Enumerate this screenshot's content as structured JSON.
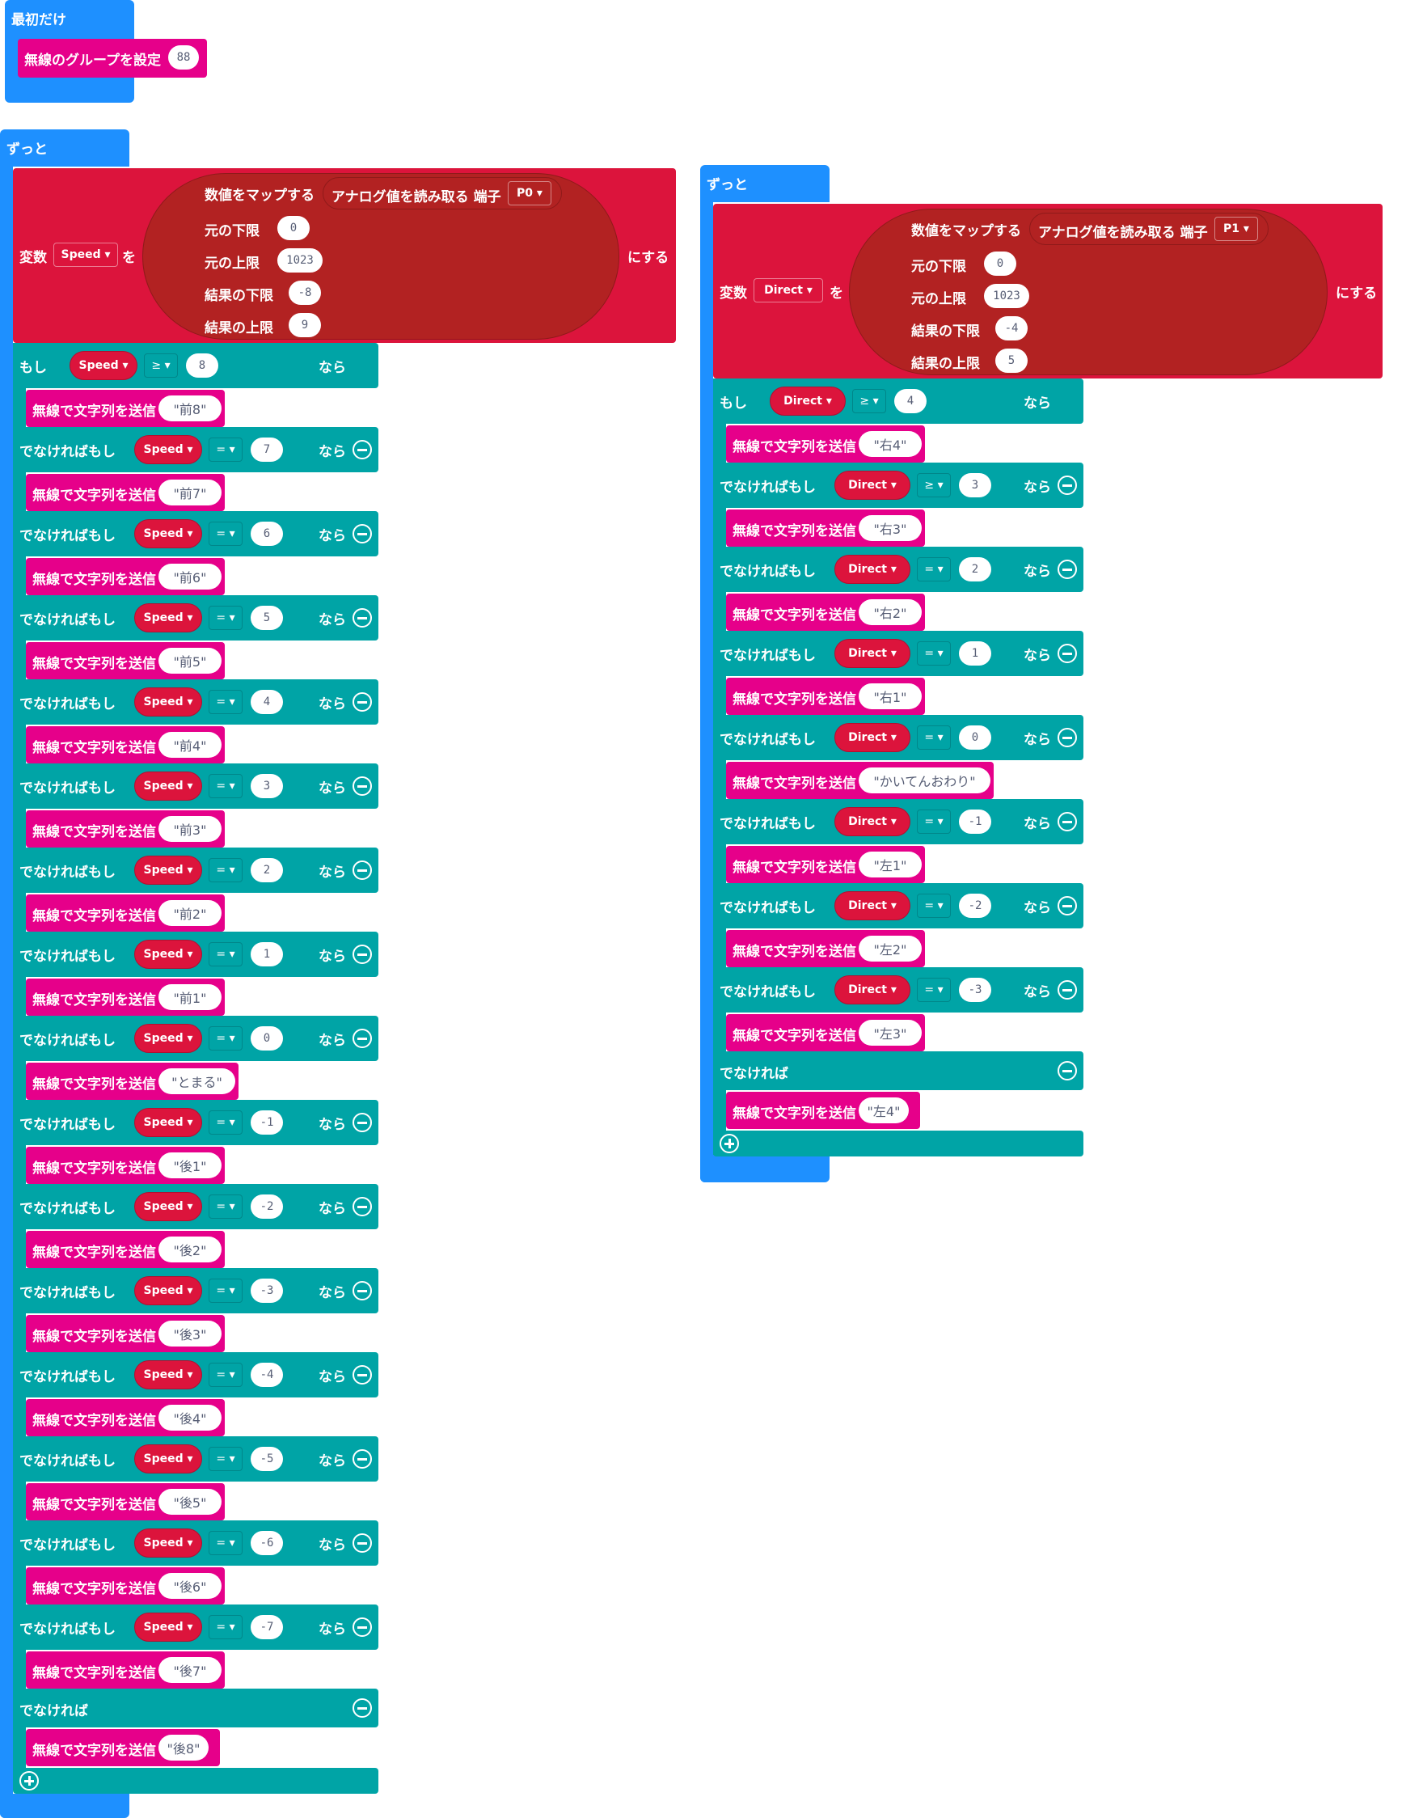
{
  "start_block": {
    "label": "最初だけ",
    "set_group_label": "無線のグループを設定",
    "group_value": "88"
  },
  "left": {
    "forever_label": "ずっと",
    "set_label": "変数",
    "var_name": "Speed",
    "to_label": "を",
    "assign_label": "にする",
    "map_label": "数値をマップする",
    "analog_label": "アナログ値を読み取る 端子",
    "pin": "P0",
    "from_low_label": "元の下限",
    "from_low": "0",
    "from_high_label": "元の上限",
    "from_high": "1023",
    "to_low_label": "結果の下限",
    "to_low": "-8",
    "to_high_label": "結果の上限",
    "to_high": "9",
    "if_label": "もし",
    "then_label": "なら",
    "elseif_label": "でなければもし",
    "else_label": "でなければ",
    "send_label": "無線で文字列を送信",
    "branches": [
      {
        "op": "≥",
        "value": "8",
        "message": "\"前8\""
      },
      {
        "op": "=",
        "value": "7",
        "message": "\"前7\""
      },
      {
        "op": "=",
        "value": "6",
        "message": "\"前6\""
      },
      {
        "op": "=",
        "value": "5",
        "message": "\"前5\""
      },
      {
        "op": "=",
        "value": "4",
        "message": "\"前4\""
      },
      {
        "op": "=",
        "value": "3",
        "message": "\"前3\""
      },
      {
        "op": "=",
        "value": "2",
        "message": "\"前2\""
      },
      {
        "op": "=",
        "value": "1",
        "message": "\"前1\""
      },
      {
        "op": "=",
        "value": "0",
        "message": "\"とまる\""
      },
      {
        "op": "=",
        "value": "-1",
        "message": "\"後1\""
      },
      {
        "op": "=",
        "value": "-2",
        "message": "\"後2\""
      },
      {
        "op": "=",
        "value": "-3",
        "message": "\"後3\""
      },
      {
        "op": "=",
        "value": "-4",
        "message": "\"後4\""
      },
      {
        "op": "=",
        "value": "-5",
        "message": "\"後5\""
      },
      {
        "op": "=",
        "value": "-6",
        "message": "\"後6\""
      },
      {
        "op": "=",
        "value": "-7",
        "message": "\"後7\""
      }
    ],
    "else_message": "\"後8\""
  },
  "right": {
    "forever_label": "ずっと",
    "set_label": "変数",
    "var_name": "Direct",
    "to_label": "を",
    "assign_label": "にする",
    "map_label": "数値をマップする",
    "analog_label": "アナログ値を読み取る 端子",
    "pin": "P1",
    "from_low_label": "元の下限",
    "from_low": "0",
    "from_high_label": "元の上限",
    "from_high": "1023",
    "to_low_label": "結果の下限",
    "to_low": "-4",
    "to_high_label": "結果の上限",
    "to_high": "5",
    "if_label": "もし",
    "then_label": "なら",
    "elseif_label": "でなければもし",
    "else_label": "でなければ",
    "send_label": "無線で文字列を送信",
    "branches": [
      {
        "op": "≥",
        "value": "4",
        "message": "\"右4\""
      },
      {
        "op": "≥",
        "value": "3",
        "message": "\"右3\""
      },
      {
        "op": "=",
        "value": "2",
        "message": "\"右2\""
      },
      {
        "op": "=",
        "value": "1",
        "message": "\"右1\""
      },
      {
        "op": "=",
        "value": "0",
        "message": "\"かいてんおわり\""
      },
      {
        "op": "=",
        "value": "-1",
        "message": "\"左1\""
      },
      {
        "op": "=",
        "value": "-2",
        "message": "\"左2\""
      },
      {
        "op": "=",
        "value": "-3",
        "message": "\"左3\""
      }
    ],
    "else_message": "\"左4\""
  },
  "colors": {
    "basic": "#1e90ff",
    "logic": "#00a4a6",
    "variables": "#dc143c",
    "math": "#b22222",
    "radio": "#e6008a"
  }
}
